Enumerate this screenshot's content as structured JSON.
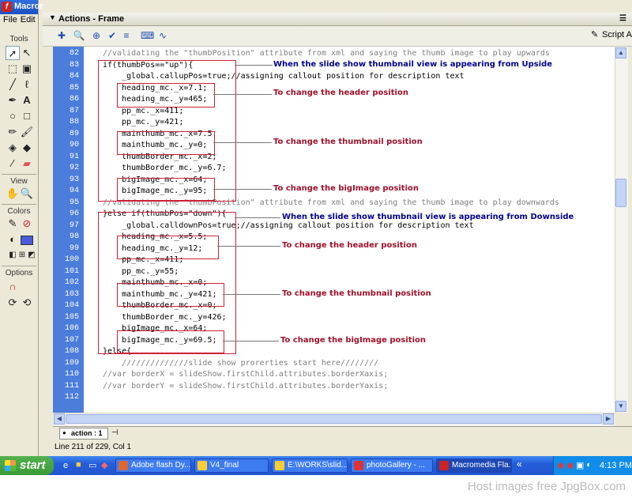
{
  "app": {
    "title": "Macromedia Flash",
    "title_visible": "Macror",
    "menu": [
      "File",
      "Edit"
    ],
    "sections": [
      "Tools",
      "View",
      "Colors",
      "Options"
    ]
  },
  "panel": {
    "title": "Actions - Frame",
    "script_assist_label": "Script Assist"
  },
  "code_lines": [
    {
      "n": "82",
      "text": "//validating the \"thumbPosition\" attribute from xml and saying the thumb image to play upwards"
    },
    {
      "n": "83",
      "text": "if(thumbPos==\"up\"){"
    },
    {
      "n": "84",
      "text": "    _global.callupPos=true;//assigning callout position for description text"
    },
    {
      "n": "85",
      "text": "    heading_mc._x=7.1;"
    },
    {
      "n": "86",
      "text": "    heading_mc._y=465;"
    },
    {
      "n": "87",
      "text": "    pp_mc._x=411;"
    },
    {
      "n": "88",
      "text": "    pp_mc._y=421;"
    },
    {
      "n": "89",
      "text": "    mainthumb_mc._x=7.5"
    },
    {
      "n": "90",
      "text": "    mainthumb_mc._y=0;"
    },
    {
      "n": "91",
      "text": "    thumbBorder_mc._x=2;"
    },
    {
      "n": "92",
      "text": "    thumbBorder_mc._y=6.7;"
    },
    {
      "n": "93",
      "text": "    bigImage_mc._x=64;"
    },
    {
      "n": "94",
      "text": "    bigImage_mc._y=95;"
    },
    {
      "n": "95",
      "text": "//validating the \"thumbPosition\" attribute from xml and saying the thumb image to play downwards"
    },
    {
      "n": "96",
      "text": "}else if(thumbPos=\"down\"){"
    },
    {
      "n": "97",
      "text": "    _global.calldownPos=true;//assigning callout position for description text"
    },
    {
      "n": "98",
      "text": "    heading_mc._x=5.5;"
    },
    {
      "n": "99",
      "text": "    heading_mc._y=12;"
    },
    {
      "n": "100",
      "text": "    pp_mc._x=411;"
    },
    {
      "n": "101",
      "text": "    pp_mc._y=55;"
    },
    {
      "n": "102",
      "text": "    mainthumb_mc._x=0;"
    },
    {
      "n": "103",
      "text": "    mainthumb_mc._y=421;"
    },
    {
      "n": "104",
      "text": "    thumbBorder_mc._x=0;"
    },
    {
      "n": "105",
      "text": "    thumbBorder_mc._y=426;"
    },
    {
      "n": "106",
      "text": "    bigImage_mc._x=64;"
    },
    {
      "n": "107",
      "text": "    bigImage_mc._y=69.5;"
    },
    {
      "n": "108",
      "text": "}else{"
    },
    {
      "n": "109",
      "text": "    //////////////slide show prorerties start here////////"
    },
    {
      "n": "110",
      "text": "//var borderX = slideShow.firstChild.attributes.borderXaxis;"
    },
    {
      "n": "111",
      "text": "//var borderY = slideShow.firstChild.attributes.borderYaxis;"
    },
    {
      "n": "112",
      "text": ""
    }
  ],
  "annotations": {
    "up_block": "When the slide show thumbnail view is appearing from Upside",
    "down_block": "When the slide show thumbnail view is appearing from Downside",
    "header_up": "To change the header position",
    "thumb_up": "To change the thumbnail position",
    "big_up": "To change the bigImage position",
    "header_down": "To change the header position",
    "thumb_down": "To change the thumbnail position",
    "big_down": "To change the bigImage position"
  },
  "tab": {
    "label": "action : 1"
  },
  "status": {
    "text": "Line 211 of 229, Col 1"
  },
  "taskbar": {
    "start_label": "start",
    "tasks": [
      "Adobe flash Dy...",
      "V4_final",
      "E:\\WORKS\\slid...",
      "photoGallery - ...",
      "Macromedia Fla..."
    ],
    "clock": "4:13 PM"
  },
  "footer": {
    "text": "Host images free JpgBox.com"
  },
  "colors": {
    "gutter": "#4d7ddb",
    "annotation_red": "#a0102a",
    "annotation_blue": "#00008b",
    "box_red": "#cc2233"
  }
}
